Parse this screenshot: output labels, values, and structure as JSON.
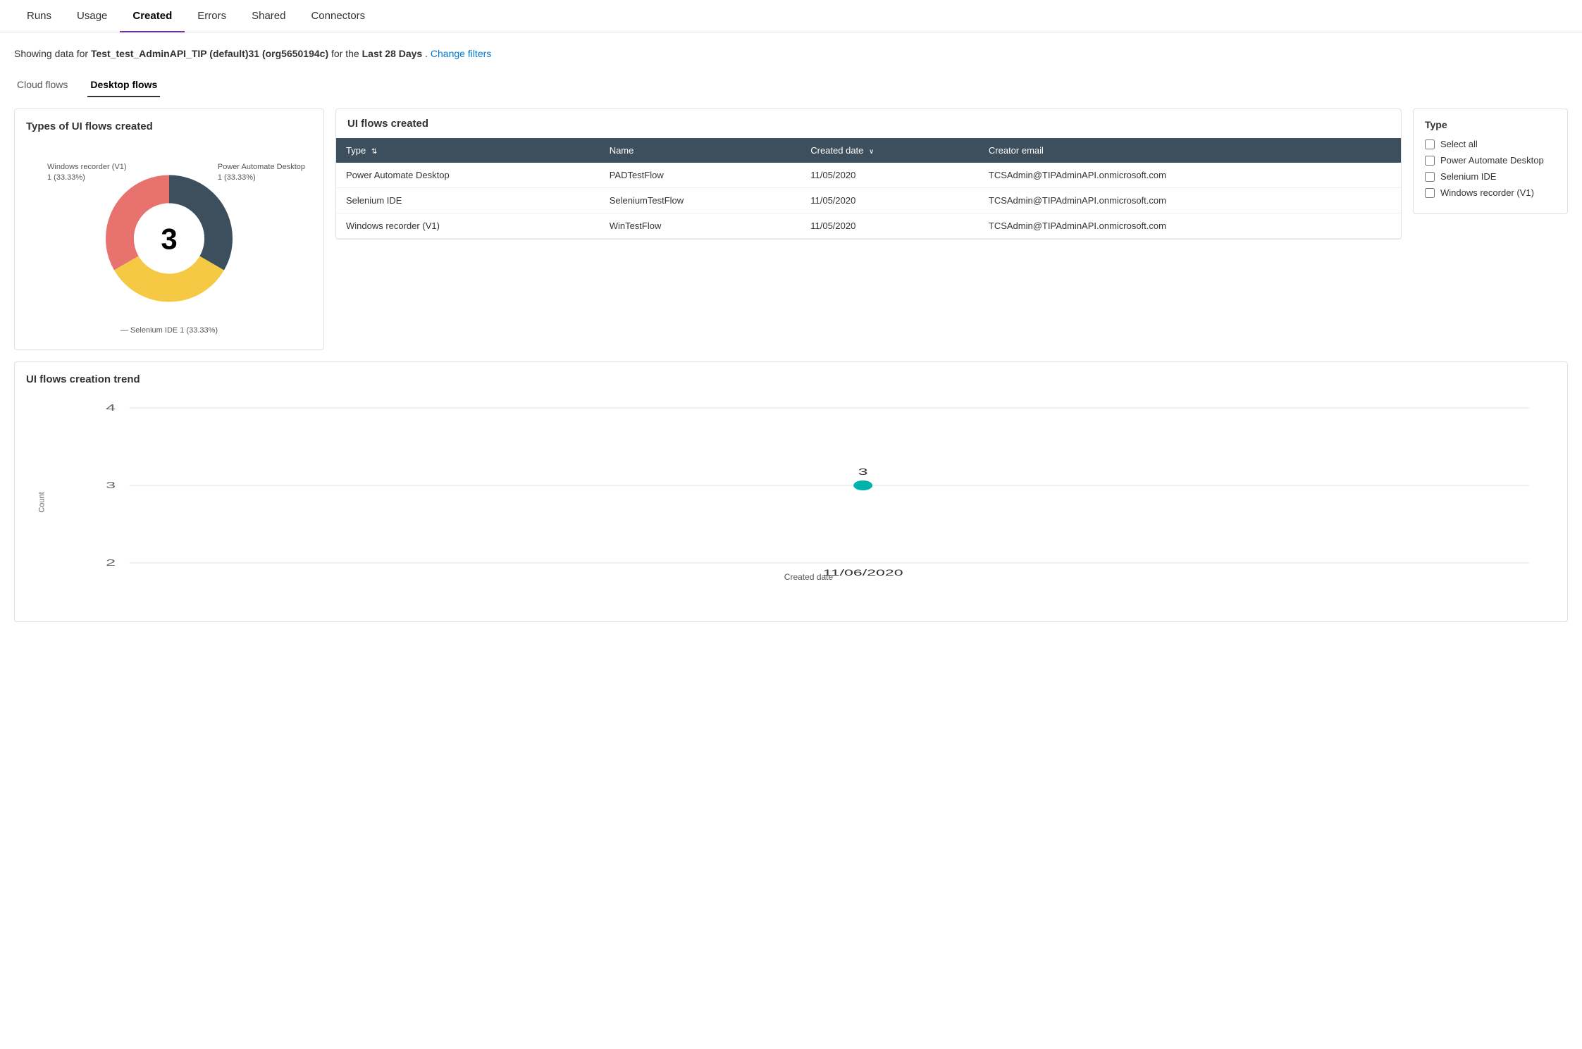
{
  "nav": {
    "tabs": [
      {
        "id": "runs",
        "label": "Runs",
        "active": false
      },
      {
        "id": "usage",
        "label": "Usage",
        "active": false
      },
      {
        "id": "created",
        "label": "Created",
        "active": true
      },
      {
        "id": "errors",
        "label": "Errors",
        "active": false
      },
      {
        "id": "shared",
        "label": "Shared",
        "active": false
      },
      {
        "id": "connectors",
        "label": "Connectors",
        "active": false
      }
    ]
  },
  "filterBar": {
    "prefix": "Showing data for",
    "envName": "Test_test_AdminAPI_TIP (default)31 (org5650194c)",
    "forText": "for the",
    "period": "Last 28 Days",
    "suffix": ".",
    "changeFiltersLabel": "Change filters"
  },
  "subTabs": [
    {
      "id": "cloud",
      "label": "Cloud flows",
      "active": false
    },
    {
      "id": "desktop",
      "label": "Desktop flows",
      "active": true
    }
  ],
  "donutChart": {
    "title": "Types of UI flows created",
    "total": "3",
    "segments": [
      {
        "label": "Power Automate Desktop",
        "value": 1,
        "pct": "33.33%",
        "color": "#3d4f5c"
      },
      {
        "label": "Windows recorder (V1)",
        "value": 1,
        "pct": "33.33%",
        "color": "#f6c944"
      },
      {
        "label": "Selenium IDE",
        "value": 1,
        "pct": "33.33%",
        "color": "#e8736e"
      }
    ],
    "labels": {
      "windowsRecorder": "Windows recorder (V1)\n1 (33.33%)",
      "powerAutomate": "Power Automate Desktop\n1 (33.33%)",
      "seleniumIde": "Selenium IDE 1 (33.33%)"
    }
  },
  "table": {
    "title": "UI flows created",
    "columns": [
      {
        "id": "type",
        "label": "Type",
        "sortable": true
      },
      {
        "id": "name",
        "label": "Name",
        "sortable": false
      },
      {
        "id": "createdDate",
        "label": "Created date",
        "sortable": true,
        "sorted": "desc"
      },
      {
        "id": "creatorEmail",
        "label": "Creator email",
        "sortable": false
      }
    ],
    "rows": [
      {
        "type": "Power Automate Desktop",
        "name": "PADTestFlow",
        "createdDate": "11/05/2020",
        "creatorEmail": "TCSAdmin@TIPAdminAPI.onmicrosoft.com"
      },
      {
        "type": "Selenium IDE",
        "name": "SeleniumTestFlow",
        "createdDate": "11/05/2020",
        "creatorEmail": "TCSAdmin@TIPAdminAPI.onmicrosoft.com"
      },
      {
        "type": "Windows recorder (V1)",
        "name": "WinTestFlow",
        "createdDate": "11/05/2020",
        "creatorEmail": "TCSAdmin@TIPAdminAPI.onmicrosoft.com"
      }
    ]
  },
  "filterPanel": {
    "title": "Type",
    "options": [
      {
        "id": "selectAll",
        "label": "Select all",
        "checked": false
      },
      {
        "id": "pad",
        "label": "Power Automate Desktop",
        "checked": false
      },
      {
        "id": "selenium",
        "label": "Selenium IDE",
        "checked": false
      },
      {
        "id": "windows",
        "label": "Windows recorder (V1)",
        "checked": false
      }
    ]
  },
  "trendChart": {
    "title": "UI flows creation trend",
    "yAxisLabel": "Count",
    "xAxisLabel": "Created date",
    "yMin": 2,
    "yMax": 4,
    "dataPoints": [
      {
        "x": "11/06/2020",
        "y": 3
      }
    ],
    "yGridLines": [
      2,
      3,
      4
    ],
    "pointColor": "#00b2a9",
    "pointLabel": "3"
  }
}
